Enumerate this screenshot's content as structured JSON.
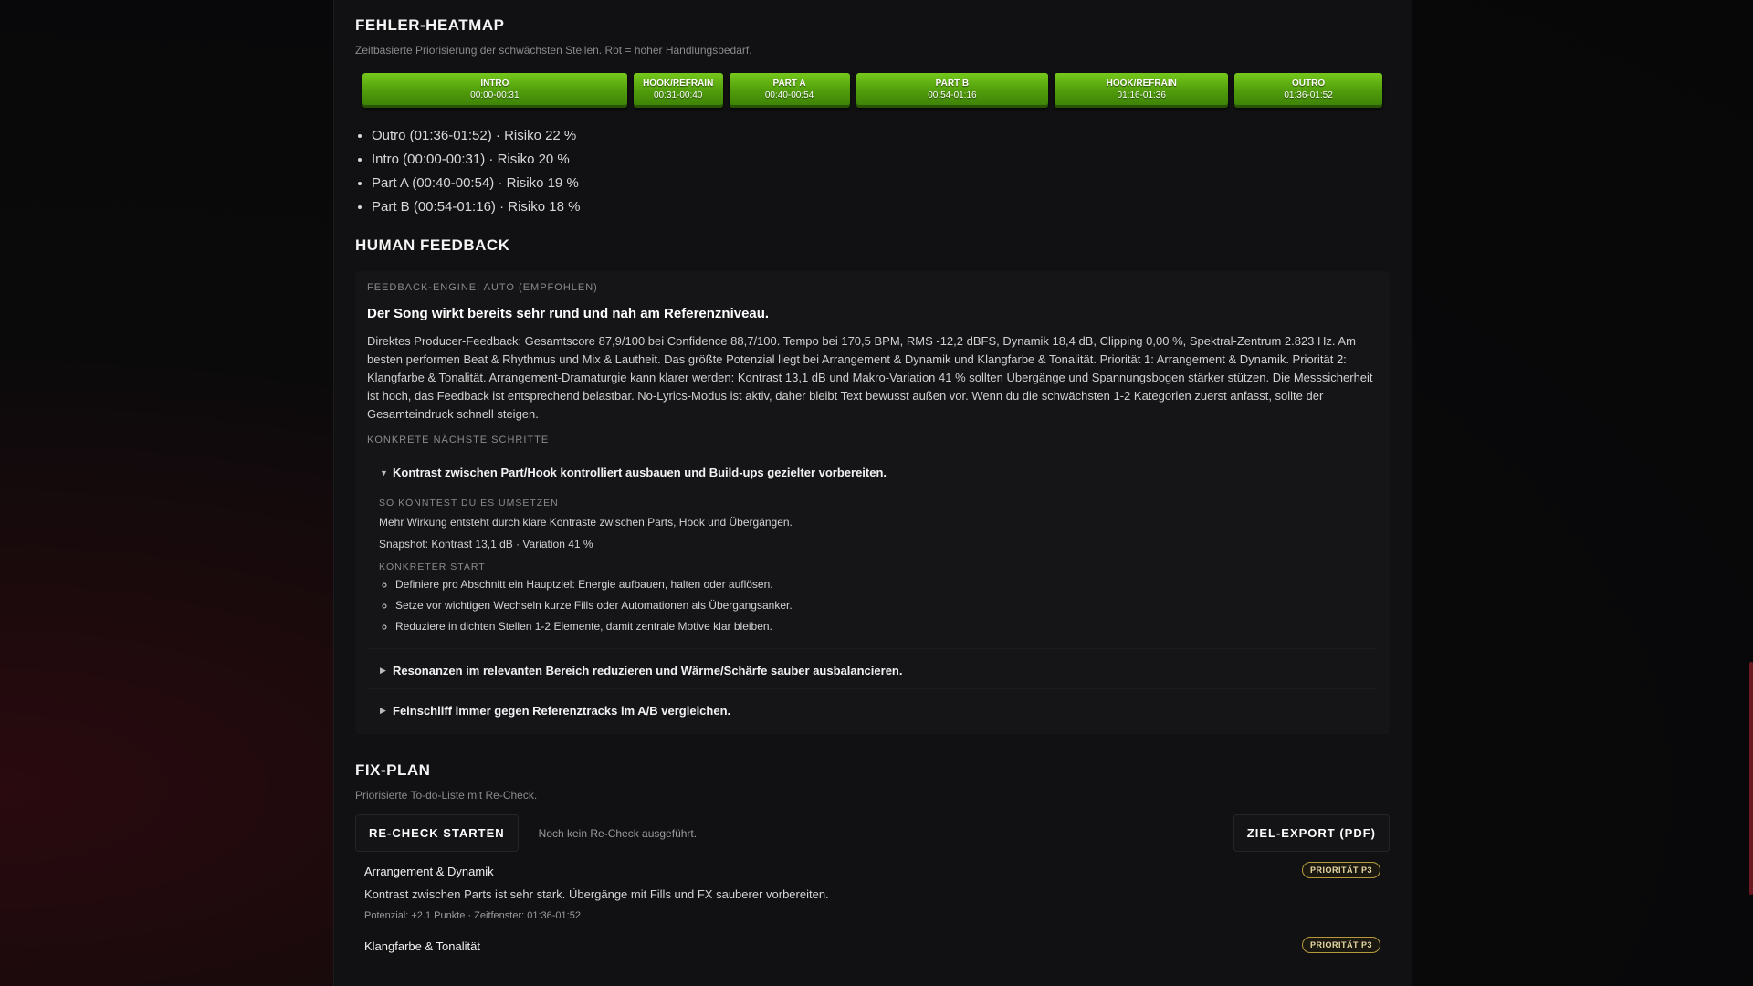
{
  "heatmap": {
    "title": "FEHLER-HEATMAP",
    "subtitle": "Zeitbasierte Priorisierung der schwächsten Stellen. Rot = hoher Handlungsbedarf.",
    "segments": [
      {
        "label": "INTRO",
        "time": "00:00-00:31"
      },
      {
        "label": "HOOK/REFRAIN",
        "time": "00:31-00:40"
      },
      {
        "label": "PART A",
        "time": "00:40-00:54"
      },
      {
        "label": "PART B",
        "time": "00:54-01:16"
      },
      {
        "label": "HOOK/REFRAIN",
        "time": "01:16-01:36"
      },
      {
        "label": "OUTRO",
        "time": "01:36-01:52"
      }
    ],
    "risks": [
      "Outro (01:36-01:52) · Risiko 22 %",
      "Intro (00:00-00:31) · Risiko 20 %",
      "Part A (00:40-00:54) · Risiko 19 %",
      "Part B (00:54-01:16) · Risiko 18 %"
    ]
  },
  "feedback": {
    "title": "HUMAN FEEDBACK",
    "engine": "FEEDBACK-ENGINE: AUTO (EMPFOHLEN)",
    "headline": "Der Song wirkt bereits sehr rund und nah am Referenzniveau.",
    "body": "Direktes Producer-Feedback: Gesamtscore 87,9/100 bei Confidence 88,7/100. Tempo bei 170,5 BPM, RMS -12,2 dBFS, Dynamik 18,4 dB, Clipping 0,00 %, Spektral-Zentrum 2.823 Hz. Am besten performen Beat & Rhythmus und Mix & Lautheit. Das größte Potenzial liegt bei Arrangement & Dynamik und Klangfarbe & Tonalität. Priorität 1: Arrangement & Dynamik. Priorität 2: Klangfarbe & Tonalität. Arrangement-Dramaturgie kann klarer werden: Kontrast 13,1 dB und Makro-Variation 41 % sollten Übergänge und Spannungsbogen stärker stützen. Die Messsicherheit ist hoch, das Feedback ist entsprechend belastbar. No-Lyrics-Modus ist aktiv, daher bleibt Text bewusst außen vor. Wenn du die schwächsten 1-2 Kategorien zuerst anfasst, sollte der Gesamteindruck schnell steigen.",
    "steps_label": "KONKRETE NÄCHSTE SCHRITTE",
    "step1": {
      "title": "Kontrast zwischen Part/Hook kontrolliert ausbauen und Build-ups gezielter vorbereiten.",
      "how_label": "SO KÖNNTEST DU ES UMSETZEN",
      "how_text": "Mehr Wirkung entsteht durch klare Kontraste zwischen Parts, Hook und Übergängen.",
      "snapshot": "Snapshot: Kontrast 13,1 dB · Variation 41 %",
      "start_label": "KONKRETER START",
      "bullets": [
        "Definiere pro Abschnitt ein Hauptziel: Energie aufbauen, halten oder auflösen.",
        "Setze vor wichtigen Wechseln kurze Fills oder Automationen als Übergangsanker.",
        "Reduziere in dichten Stellen 1-2 Elemente, damit zentrale Motive klar bleiben."
      ]
    },
    "step2": {
      "title": "Resonanzen im relevanten Bereich reduzieren und Wärme/Schärfe sauber ausbalancieren."
    },
    "step3": {
      "title": "Feinschliff immer gegen Referenztracks im A/B vergleichen."
    },
    "caret_open": "▼",
    "caret_closed": "▶"
  },
  "fixplan": {
    "title": "FIX-PLAN",
    "subtitle": "Priorisierte To-do-Liste mit Re-Check.",
    "recheck_label": "RE-CHECK STARTEN",
    "status": "Noch kein Re-Check ausgeführt.",
    "export_label": "ZIEL-EXPORT (PDF)",
    "items": [
      {
        "title": "Arrangement & Dynamik",
        "desc": "Kontrast zwischen Parts ist sehr stark. Übergänge mit Fills und FX sauberer vorbereiten.",
        "meta": "Potenzial: +2.1 Punkte · Zeitfenster: 01:36-01:52",
        "badge": "PRIORITÄT P3"
      },
      {
        "title": "Klangfarbe & Tonalität",
        "badge": "PRIORITÄT P3"
      }
    ]
  }
}
